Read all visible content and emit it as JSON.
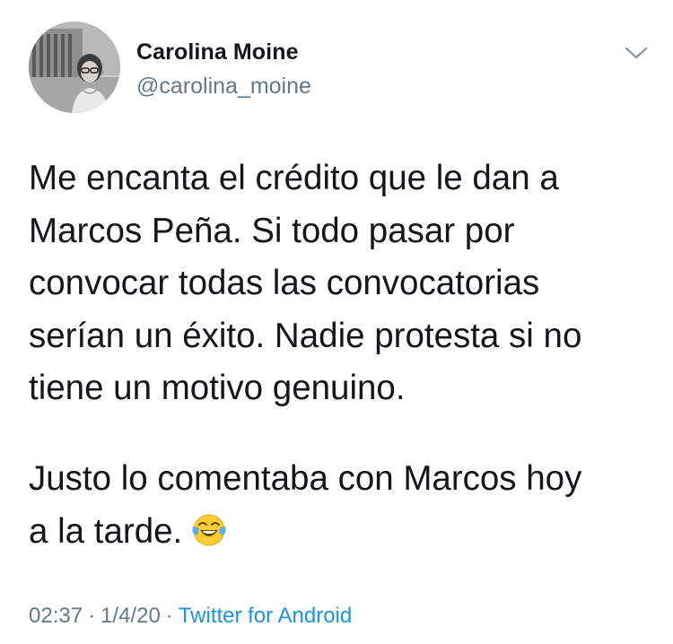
{
  "user": {
    "name": "Carolina Moine",
    "handle": "@carolina_moine"
  },
  "tweet": {
    "line1": "Me encanta el crédito que le dan a",
    "line2": "Marcos Peña. Si todo pasar por",
    "line3": "convocar todas las convocatorias",
    "line4": "serían un éxito. Nadie protesta si no",
    "line5": "tiene un motivo genuino.",
    "line6": "Justo lo comentaba con Marcos hoy",
    "line7": "a la tarde."
  },
  "meta": {
    "time": "02:37",
    "separator": "·",
    "date": "1/4/20",
    "source": "Twitter for Android"
  },
  "icons": {
    "menu": "chevron-down-icon",
    "emoji": "face-with-tears-of-joy-emoji"
  },
  "colors": {
    "text": "#14171a",
    "secondary": "#657786",
    "link": "#1b95e0"
  }
}
